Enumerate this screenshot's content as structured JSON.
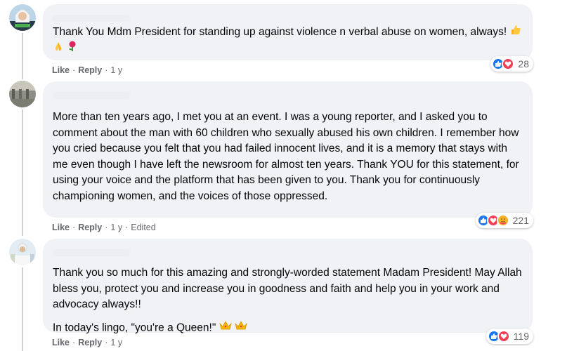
{
  "colors": {
    "bubble": "#f0f2f5",
    "like_blue": "#1877f2",
    "love_red": "#f33e58",
    "care_yellow": "#f7b125",
    "meta_gray": "#65676b"
  },
  "comments": [
    {
      "text": [
        "Thank You Mdm President for standing up against violence n verbal abuse on women, always!"
      ],
      "trailing_emojis": [
        "thumbs-up",
        "folded-hands",
        "rose"
      ],
      "reactions": {
        "icons": [
          "like-icon",
          "love-icon"
        ],
        "count": "28"
      },
      "actions": {
        "like": "Like",
        "reply": "Reply",
        "time": "1 y",
        "edited": ""
      }
    },
    {
      "text": [
        "More than ten years ago, I met you at an event. I was a young reporter, and I asked you to comment about the man with 60 children who sexually abused his own children. I remember how you cried because you felt that you had failed innocent lives, and it is a memory that stays with me even though I have left the newsroom for almost ten years. Thank YOU for this statement, for using your voice and the platform that has been given to you. Thank you for continuously championing women, and the voices of those oppressed."
      ],
      "reactions": {
        "icons": [
          "like-icon",
          "love-icon",
          "care-icon"
        ],
        "count": "221"
      },
      "actions": {
        "like": "Like",
        "reply": "Reply",
        "time": "1 y",
        "edited": "Edited"
      }
    },
    {
      "text": [
        "Thank you so much for this amazing and strongly-worded statement Madam President! May Allah bless you, protect you and increase you in goodness and faith and help you in your work and advocacy always!!",
        "In today's lingo, \"you're a Queen!\""
      ],
      "trailing_emojis": [
        "crown",
        "crown"
      ],
      "reactions": {
        "icons": [
          "like-icon",
          "love-icon"
        ],
        "count": "119"
      },
      "actions": {
        "like": "Like",
        "reply": "Reply",
        "time": "1 y",
        "edited": ""
      }
    }
  ]
}
